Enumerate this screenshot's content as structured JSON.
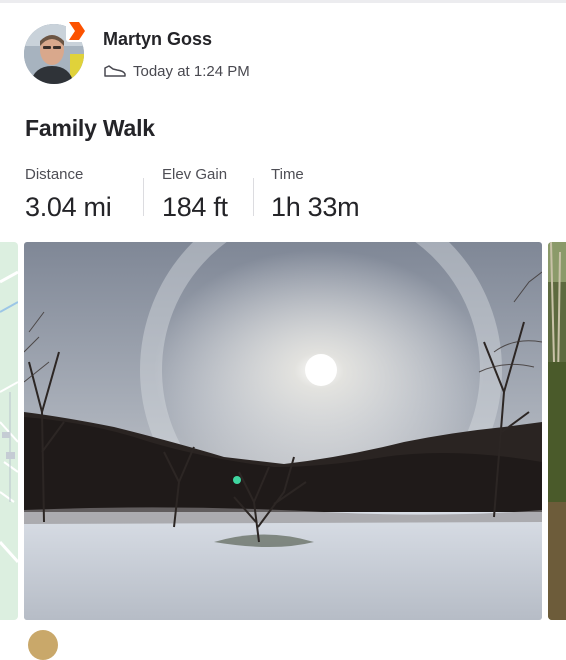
{
  "activity": {
    "athlete_name": "Martyn Goss",
    "time_label": "Today at 1:24 PM",
    "activity_type_icon": "walking-shoe-icon",
    "title": "Family Walk"
  },
  "stats": [
    {
      "label": "Distance",
      "value": "3.04 mi"
    },
    {
      "label": "Elev Gain",
      "value": "184 ft"
    },
    {
      "label": "Time",
      "value": "1h 33m"
    }
  ],
  "colors": {
    "brand_orange": "#fc5200",
    "text_primary": "#242428",
    "text_secondary": "#4e4e55",
    "map_green": "#cfe8d4"
  },
  "media": {
    "items": [
      "route-map",
      "photo",
      "photo"
    ]
  }
}
